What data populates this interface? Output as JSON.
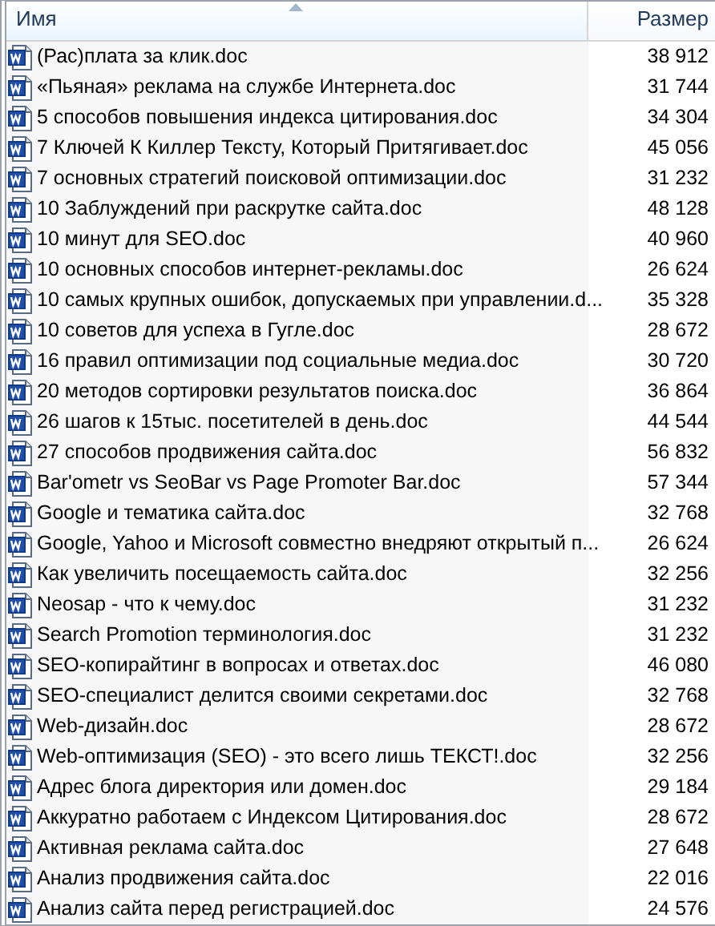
{
  "columns": [
    {
      "label": "Имя",
      "sorted": true
    },
    {
      "label": "Размер",
      "sorted": false
    }
  ],
  "rows": [
    {
      "name": "(Рас)плата за клик.doc",
      "size": "38 912"
    },
    {
      "name": "«Пьяная» реклама на службе Интернета.doc",
      "size": "31 744"
    },
    {
      "name": "5 способов повышения индекса цитирования.doc",
      "size": "34 304"
    },
    {
      "name": "7 Ключей К Киллер Тексту, Который Притягивает.doc",
      "size": "45 056"
    },
    {
      "name": "7 основных стратегий поисковой оптимизации.doc",
      "size": "31 232"
    },
    {
      "name": "10 Заблуждений при раскрутке сайта.doc",
      "size": "48 128"
    },
    {
      "name": "10 минут для SEO.doc",
      "size": "40 960"
    },
    {
      "name": "10 основных способов интернет-рекламы.doc",
      "size": "26 624"
    },
    {
      "name": "10 самых крупных ошибок, допускаемых при управлении.d...",
      "size": "35 328"
    },
    {
      "name": "10 советов для успеха в Гугле.doc",
      "size": "28 672"
    },
    {
      "name": "16 правил оптимизации под социальные медиа.doc",
      "size": "30 720"
    },
    {
      "name": "20 методов сортировки результатов поиска.doc",
      "size": "36 864"
    },
    {
      "name": "26 шагов к 15тыс. посетителей в день.doc",
      "size": "44 544"
    },
    {
      "name": "27 способов продвижения сайта.doc",
      "size": "56 832"
    },
    {
      "name": "Bar'ometr vs SeoBar vs Page Promoter Bar.doc",
      "size": "57 344"
    },
    {
      "name": "Google и тематика сайта.doc",
      "size": "32 768"
    },
    {
      "name": "Google, Yahoo и Microsoft совместно внедряют открытый п...",
      "size": "26 624"
    },
    {
      "name": "Как увеличить посещаемость сайта.doc",
      "size": "32 256"
    },
    {
      "name": "Neosap - что к чему.doc",
      "size": "31 232"
    },
    {
      "name": "Search Promotion терминология.doc",
      "size": "31 232"
    },
    {
      "name": "SEO-копирайтинг в вопросах и ответах.doc",
      "size": "46 080"
    },
    {
      "name": "SEO-специалист делится своими секретами.doc",
      "size": "32 768"
    },
    {
      "name": "Web-дизайн.doc",
      "size": "28 672"
    },
    {
      "name": "Web-оптимизация (SEO) - это всего лишь ТЕКСТ!.doc",
      "size": "32 256"
    },
    {
      "name": "Адрес блога директория или домен.doc",
      "size": "29 184"
    },
    {
      "name": "Аккуратно работаем с Индексом Цитирования.doc",
      "size": "28 672"
    },
    {
      "name": "Активная реклама сайта.doc",
      "size": "27 648"
    },
    {
      "name": "Анализ продвижения сайта.doc",
      "size": "22 016"
    },
    {
      "name": "Анализ сайта перед регистрацией.doc",
      "size": "24 576"
    }
  ]
}
